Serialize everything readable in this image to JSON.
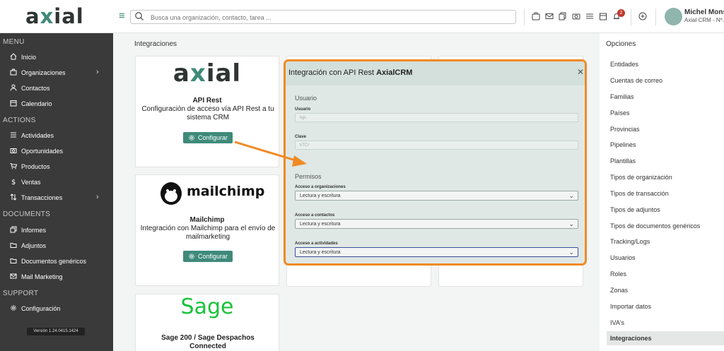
{
  "header": {
    "logo_text": "axial",
    "search_placeholder": "Busca una organización, contacto, tarea ...",
    "notification_count": "2",
    "user_name": "Michel Mons",
    "user_sub": "Axial CRM - Nº. C"
  },
  "sidebar": {
    "sections": [
      {
        "title": "MENU",
        "items": [
          {
            "label": "Inicio",
            "icon": "home-icon"
          },
          {
            "label": "Organizaciones",
            "icon": "briefcase-icon",
            "chevron": true
          },
          {
            "label": "Contactos",
            "icon": "user-icon"
          },
          {
            "label": "Calendario",
            "icon": "calendar-icon"
          }
        ]
      },
      {
        "title": "ACTIONS",
        "items": [
          {
            "label": "Actividades",
            "icon": "list-icon"
          },
          {
            "label": "Oportunidades",
            "icon": "camera-icon"
          },
          {
            "label": "Productos",
            "icon": "cart-icon"
          },
          {
            "label": "Ventas",
            "icon": "dollar-icon"
          },
          {
            "label": "Transacciones",
            "icon": "transfer-icon",
            "chevron": true
          }
        ]
      },
      {
        "title": "DOCUMENTS",
        "items": [
          {
            "label": "Informes",
            "icon": "copy-icon"
          },
          {
            "label": "Adjuntos",
            "icon": "folder-icon"
          },
          {
            "label": "Documentos genéricos",
            "icon": "folder-icon"
          },
          {
            "label": "Mail Marketing",
            "icon": "mail-icon"
          }
        ]
      },
      {
        "title": "SUPPORT",
        "items": [
          {
            "label": "Configuración",
            "icon": "gear-icon"
          }
        ]
      }
    ],
    "version": "Versión 1.24.0415.1424"
  },
  "main": {
    "title": "Integraciones",
    "cards": [
      {
        "logo": "axial",
        "title": "API Rest",
        "description": "Configuración de acceso vía API Rest a tu sistema CRM",
        "button": "Configurar"
      },
      {
        "logo": "mailchimp",
        "title": "Mailchimp",
        "description": "Integración con Mailchimp para el envío de mailmarketing",
        "button": "Configurar"
      },
      {
        "logo": "Sage",
        "title": "Sage 200 / Sage Despachos Connected"
      }
    ]
  },
  "modal": {
    "title": "Integración con API Rest",
    "title_bold": "AxialCRM",
    "section_user": "Usuario",
    "user_label": "Usuario",
    "user_value": "lqjs",
    "password_label": "Clave",
    "password_value": "hTCr",
    "section_permissions": "Permisos",
    "permissions": [
      {
        "label": "Acceso a organizaciones",
        "value": "Lectura y escritura"
      },
      {
        "label": "Acceso a contactos",
        "value": "Lectura y escritura"
      },
      {
        "label": "Acceso a actividades",
        "value": "Lectura y escritura"
      }
    ]
  },
  "options": {
    "title": "Opciones",
    "items": [
      "Entidades",
      "Cuentas de correo",
      "Familias",
      "Países",
      "Provincias",
      "Pipelines",
      "Plantillas",
      "Tipos de organización",
      "Tipos de transacción",
      "Tipos de adjuntos",
      "Tipos de documentos genéricos",
      "Tracking/Logs",
      "Usuarios",
      "Roles",
      "Zonas",
      "Importar datos",
      "IVA's",
      "Integraciones"
    ],
    "active": "Integraciones"
  },
  "colors": {
    "accent": "#3f8a7a",
    "sidebar": "#3a3a3a",
    "highlight": "#f08a24"
  }
}
